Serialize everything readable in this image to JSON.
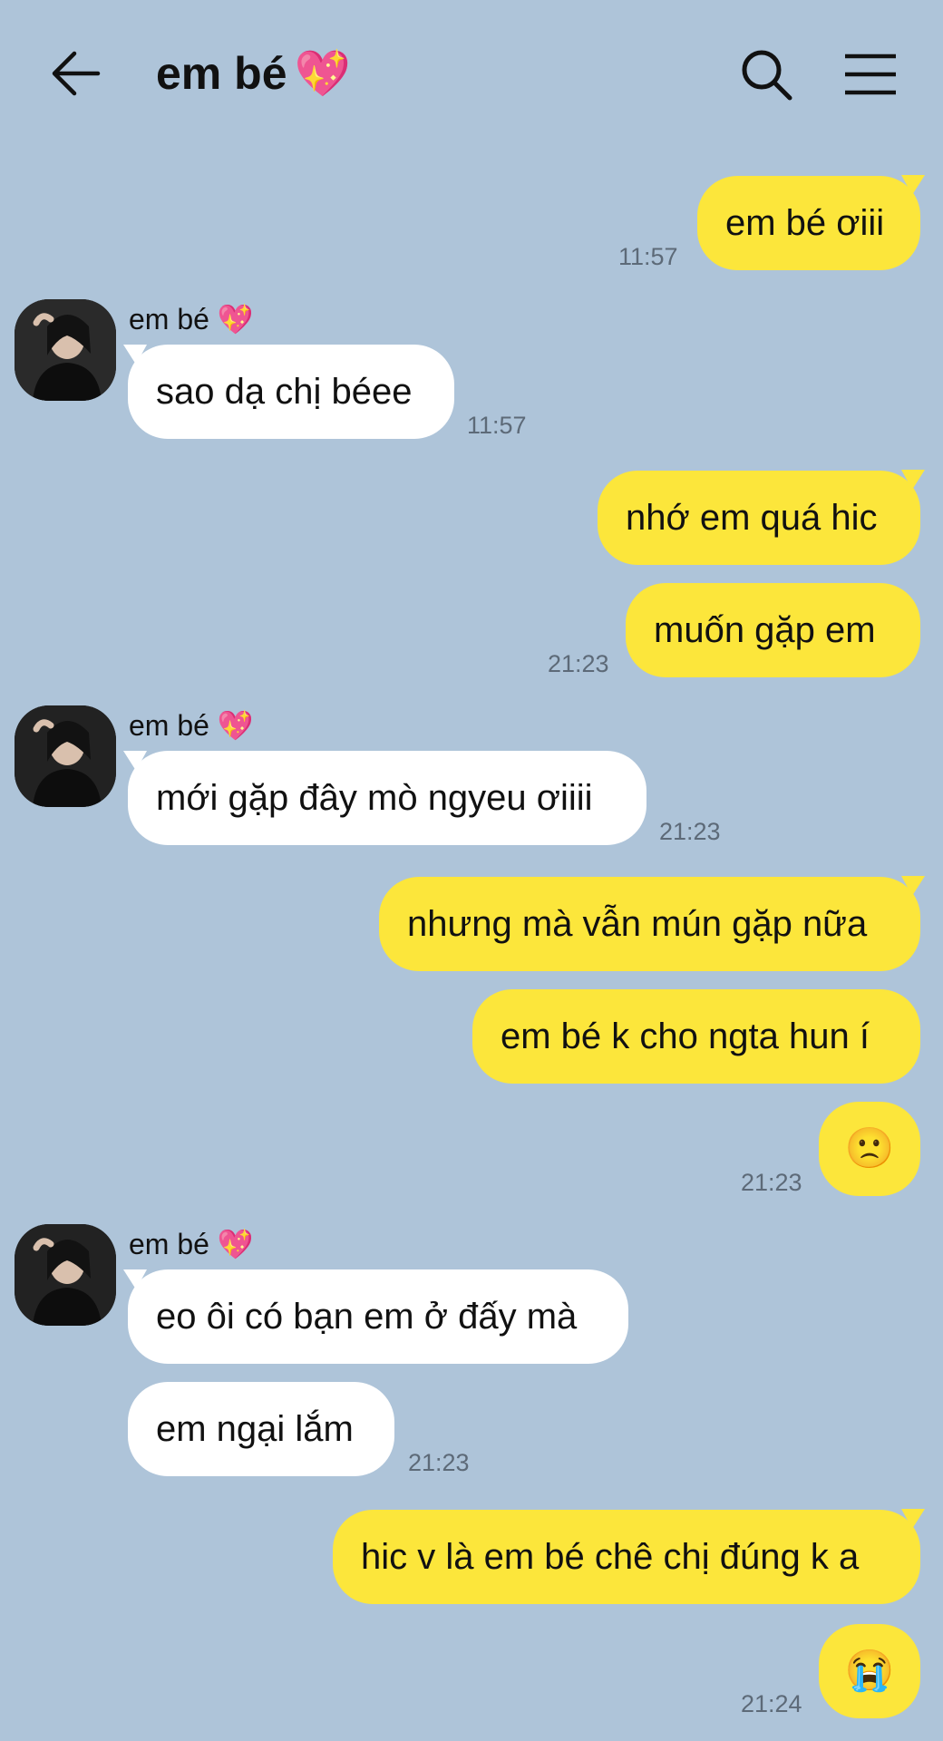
{
  "header": {
    "title": "em bé",
    "title_emoji": "💖"
  },
  "colors": {
    "background": "#aec4d9",
    "outgoing_bubble": "#fce63b",
    "incoming_bubble": "#ffffff",
    "timestamp": "#5d6a78"
  },
  "icons": {
    "back": "arrow-left-icon",
    "search": "search-icon",
    "menu": "hamburger-menu-icon",
    "heart": "sparkling-heart-icon"
  },
  "messages": {
    "m1": {
      "text": "em bé ơiii",
      "time": "11:57"
    },
    "sender_name": "em bé",
    "sender_emoji": "💖",
    "m2": {
      "text": "sao dạ chị béee",
      "time": "11:57"
    },
    "m3": {
      "text": "nhớ em quá hic"
    },
    "m4": {
      "text": "muốn gặp em",
      "time": "21:23"
    },
    "m5": {
      "text": "mới gặp đây mò ngyeu ơiiii",
      "time": "21:23"
    },
    "m6": {
      "text": "nhưng mà vẫn mún gặp nữa"
    },
    "m7": {
      "text": "em bé k cho ngta hun í"
    },
    "m8": {
      "text": "🙁",
      "time": "21:23"
    },
    "m9": {
      "text": "eo ôi có bạn em ở đấy mà"
    },
    "m10": {
      "text": "em ngại lắm",
      "time": "21:23"
    },
    "m11": {
      "text": "hic v là em bé chê chị đúng k a"
    },
    "m12": {
      "text": "😭",
      "time": "21:24"
    }
  }
}
